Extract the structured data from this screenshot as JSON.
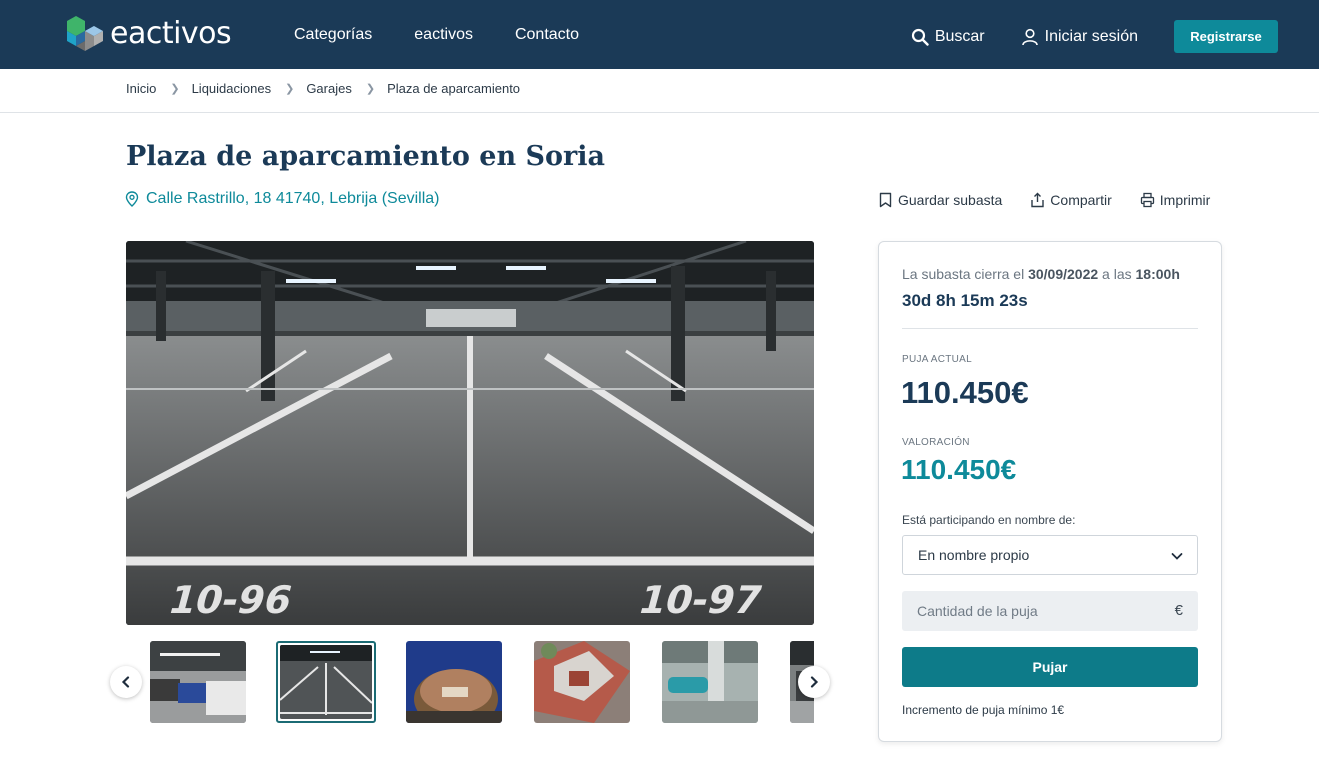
{
  "header": {
    "logo_text": "eactivos",
    "nav": [
      "Categorías",
      "eactivos",
      "Contacto"
    ],
    "search_label": "Buscar",
    "login_label": "Iniciar sesión",
    "register_label": "Registrarse",
    "colors": {
      "header_bg": "#1b3a57",
      "accent": "#0e8a9a"
    }
  },
  "breadcrumb": [
    "Inicio",
    "Liquidaciones",
    "Garajes",
    "Plaza de aparcamiento"
  ],
  "listing": {
    "title": "Plaza de aparcamiento en Soria",
    "address": "Calle Rastrillo, 18 41740, Lebrija (Sevilla)",
    "actions": {
      "save": "Guardar subasta",
      "share": "Compartir",
      "print": "Imprimir"
    },
    "main_image_icon": "parking-garage-photo",
    "thumbnails": [
      {
        "icon": "parking-cars-thumb"
      },
      {
        "icon": "empty-parking-thumb",
        "active": true
      },
      {
        "icon": "round-building-night-thumb"
      },
      {
        "icon": "aerial-buildings-thumb"
      },
      {
        "icon": "car-parking-thumb"
      },
      {
        "icon": "parking-partial-thumb"
      }
    ]
  },
  "bid_card": {
    "closes_prefix": "La subasta cierra el",
    "closes_date": "30/09/2022",
    "closes_mid": "a las",
    "closes_time": "18:00h",
    "countdown": "30d 8h 15m 23s",
    "current_bid_label": "PUJA ACTUAL",
    "current_bid": "110.450€",
    "valuation_label": "VALORACIÓN",
    "valuation": "110.450€",
    "participating_label": "Está participando en nombre de:",
    "participating_value": "En nombre propio",
    "bid_placeholder": "Cantidad de la puja",
    "currency_symbol": "€",
    "bid_button": "Pujar",
    "min_increment": "Incremento de puja mínimo 1€",
    "colors": {
      "current_bid": "#1b3a57",
      "valuation": "#0e8a9a",
      "button": "#0d7b89"
    }
  }
}
